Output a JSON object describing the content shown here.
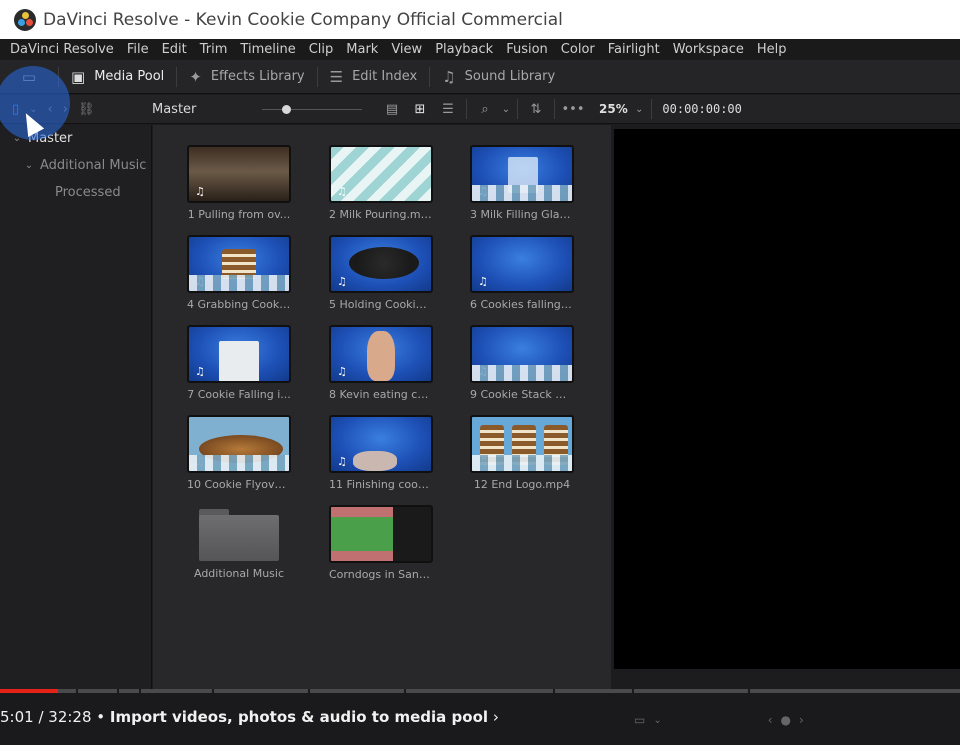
{
  "window": {
    "title": "DaVinci Resolve - Kevin Cookie Company Official Commercial"
  },
  "menu": [
    "DaVinci Resolve",
    "File",
    "Edit",
    "Trim",
    "Timeline",
    "Clip",
    "Mark",
    "View",
    "Playback",
    "Fusion",
    "Color",
    "Fairlight",
    "Workspace",
    "Help"
  ],
  "toolbar": {
    "media_pool": "Media Pool",
    "effects_library": "Effects Library",
    "edit_index": "Edit Index",
    "sound_library": "Sound Library"
  },
  "subbar": {
    "bin_title": "Master",
    "zoom": "25%",
    "timecode": "00:00:00:00"
  },
  "bins": {
    "master": "Master",
    "additional_music": "Additional Music",
    "processed": "Processed"
  },
  "clips": [
    {
      "name": "1 Pulling from ov...",
      "kind": "hall"
    },
    {
      "name": "2 Milk Pouring.mp4",
      "kind": "chev"
    },
    {
      "name": "3 Milk Filling Glas...",
      "kind": "glass"
    },
    {
      "name": "4 Grabbing Cooki...",
      "kind": "stack"
    },
    {
      "name": "5 Holding Cookie ...",
      "kind": "cookie"
    },
    {
      "name": "6 Cookies falling f...",
      "kind": "blue"
    },
    {
      "name": "7 Cookie Falling i...",
      "kind": "glass"
    },
    {
      "name": "8 Kevin eating co...",
      "kind": "face"
    },
    {
      "name": "9 Cookie Stack Gr...",
      "kind": "blue"
    },
    {
      "name": "10 Cookie Flyover...",
      "kind": "pile"
    },
    {
      "name": "11 Finishing cooki...",
      "kind": "hand"
    },
    {
      "name": "12 End Logo.mp4",
      "kind": "stacks"
    },
    {
      "name": "Additional Music",
      "kind": "folder"
    },
    {
      "name": "Corndogs in Sant...",
      "kind": "timeline"
    }
  ],
  "youtube": {
    "time": "5:01 / 32:28",
    "chapter": "Import videos, photos & audio to media pool",
    "progress": 0.06
  }
}
